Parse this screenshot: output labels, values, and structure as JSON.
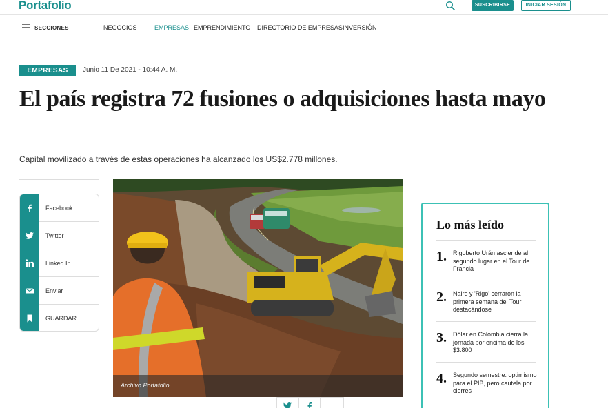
{
  "header": {
    "logo": "Portafolio",
    "subscribe_label": "SUSCRIBIRSE",
    "login_label": "INICIAR SESIÓN"
  },
  "nav": {
    "sections_label": "SECCIONES",
    "items": [
      "NEGOCIOS",
      "EMPRESAS",
      "EMPRENDIMIENTO",
      "DIRECTORIO DE EMPRESAS",
      "INVERSIÓN"
    ],
    "active_item": "EMPRESAS"
  },
  "article": {
    "tag": "EMPRESAS",
    "date": "Junio 11 De 2021 - 10:44 A. M.",
    "headline": "El país registra 72 fusiones o adquisiciones hasta mayo",
    "subtitle": "Capital movilizado a través de estas operaciones ha alcanzado los US$2.778 millones.",
    "image_caption": "Archivo Portafolio."
  },
  "share": [
    {
      "label": "Facebook",
      "icon": "facebook-icon"
    },
    {
      "label": "Twitter",
      "icon": "twitter-icon"
    },
    {
      "label": "Linked In",
      "icon": "linkedin-icon"
    },
    {
      "label": "Enviar",
      "icon": "mail-icon"
    },
    {
      "label": "GUARDAR",
      "icon": "bookmark-icon"
    }
  ],
  "most_read": {
    "title": "Lo más leído",
    "items": [
      {
        "num": "1.",
        "text": "Rigoberto Urán asciende al segundo lugar en el Tour de Francia"
      },
      {
        "num": "2.",
        "text": "Nairo y 'Rigo' cerraron la primera semana del Tour destacándose"
      },
      {
        "num": "3.",
        "text": "Dólar en Colombia cierra la jornada por encima de los $3.800"
      },
      {
        "num": "4.",
        "text": "Segundo semestre: optimismo para el PIB, pero cautela por cierres"
      }
    ]
  },
  "colors": {
    "brand": "#1a8f8d",
    "most_read_border": "#3cc1b5"
  }
}
